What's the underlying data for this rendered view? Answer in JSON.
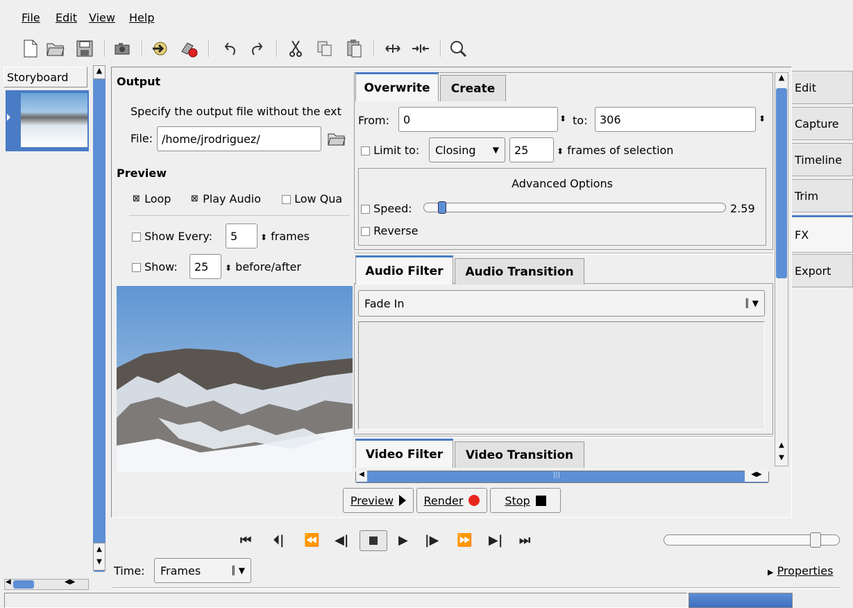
{
  "menu": {
    "file": "File",
    "edit": "Edit",
    "view": "View",
    "help": "Help"
  },
  "storyboard": {
    "tab_label": "Storyboard"
  },
  "output": {
    "heading": "Output",
    "description": "Specify the output file without the ext",
    "file_label": "File:",
    "file_value": "/home/jrodriguez/"
  },
  "preview": {
    "heading": "Preview",
    "loop_label": "Loop",
    "play_audio_label": "Play Audio",
    "low_quality_label": "Low Qua",
    "show_every_label": "Show Every:",
    "show_every_value": "5",
    "frames_suffix": "frames",
    "show_label": "Show:",
    "show_value": "25",
    "before_after_suffix": "before/after"
  },
  "range": {
    "tab_overwrite": "Overwrite",
    "tab_create": "Create",
    "from_label": "From:",
    "from_value": "0",
    "to_label": "to:",
    "to_value": "306",
    "limit_label": "Limit to:",
    "limit_mode": "Closing",
    "limit_value": "25",
    "limit_suffix": "frames of selection",
    "advanced_title": "Advanced Options",
    "speed_label": "Speed:",
    "speed_value": "2.59",
    "reverse_label": "Reverse"
  },
  "audio": {
    "tab_filter": "Audio Filter",
    "tab_transition": "Audio Transition",
    "filter_selected": "Fade In"
  },
  "video": {
    "tab_filter": "Video Filter",
    "tab_transition": "Video Transition"
  },
  "actions": {
    "preview": "Preview",
    "render": "Render",
    "stop": "Stop"
  },
  "side_tabs": [
    "Edit",
    "Capture",
    "Timeline",
    "Trim",
    "FX",
    "Export"
  ],
  "bottom": {
    "time_label": "Time:",
    "time_mode": "Frames",
    "properties": "Properties"
  },
  "colors": {
    "accent": "#4a7cc5",
    "scroll_blue": "#5d8fd6",
    "render_dot": "#e8261b"
  }
}
